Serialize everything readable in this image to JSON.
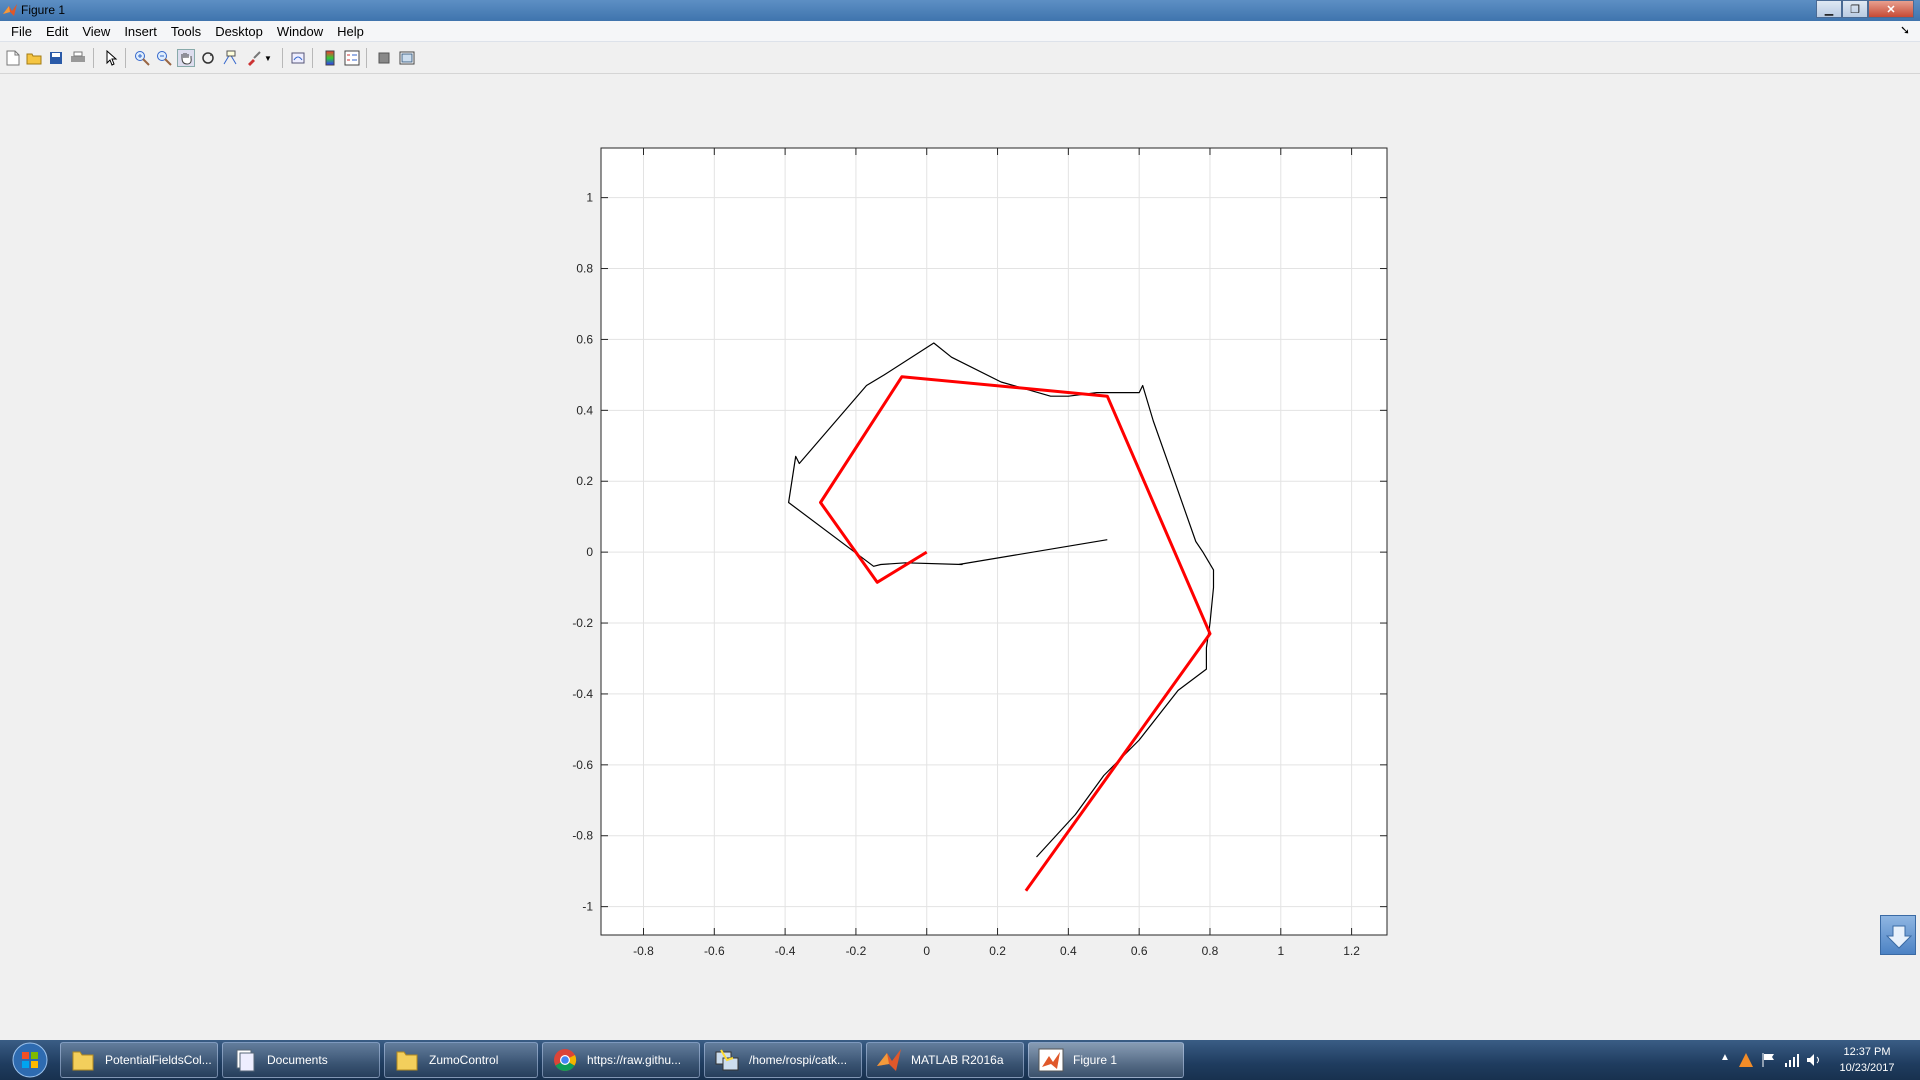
{
  "window": {
    "title": "Figure 1",
    "controls": [
      "minimize",
      "maximize",
      "close"
    ]
  },
  "menu": {
    "items": [
      "File",
      "Edit",
      "View",
      "Insert",
      "Tools",
      "Desktop",
      "Window",
      "Help"
    ]
  },
  "toolbar": {
    "icons": [
      "new-figure-icon",
      "open-icon",
      "save-icon",
      "print-icon",
      "select-arrow-icon",
      "zoom-in-icon",
      "zoom-out-icon",
      "pan-hand-icon",
      "rotate-3d-icon",
      "data-cursor-icon",
      "brush-icon",
      "link-plot-icon",
      "colorbar-icon",
      "legend-icon",
      "hide-plot-tools-icon",
      "show-plot-tools-icon"
    ],
    "active": "pan-hand-icon"
  },
  "chart_data": {
    "type": "line",
    "title": "",
    "xlabel": "",
    "ylabel": "",
    "xlim": [
      -0.92,
      1.3
    ],
    "ylim": [
      -1.08,
      1.14
    ],
    "xticks": [
      -0.8,
      -0.6,
      -0.4,
      -0.2,
      0,
      0.2,
      0.4,
      0.6,
      0.8,
      1,
      1.2
    ],
    "xtick_labels": [
      "-0.8",
      "-0.6",
      "-0.4",
      "-0.2",
      "0",
      "0.2",
      "0.4",
      "0.6",
      "0.8",
      "1",
      "1.2"
    ],
    "yticks": [
      -1,
      -0.8,
      -0.6,
      -0.4,
      -0.2,
      0,
      0.2,
      0.4,
      0.6,
      0.8,
      1
    ],
    "ytick_labels": [
      "-1",
      "-0.8",
      "-0.6",
      "-0.4",
      "-0.2",
      "0",
      "0.2",
      "0.4",
      "0.6",
      "0.8",
      "1"
    ],
    "grid": true,
    "series": [
      {
        "color": "#ff0000",
        "points": [
          [
            0,
            0
          ],
          [
            -0.14,
            -0.085
          ],
          [
            -0.3,
            0.14
          ],
          [
            -0.07,
            0.495
          ],
          [
            0.51,
            0.44
          ],
          [
            0.8,
            -0.23
          ],
          [
            0.28,
            -0.955
          ]
        ]
      },
      {
        "color": "#000000",
        "points": [
          [
            0.51,
            0.035
          ],
          [
            0.09,
            -0.035
          ],
          [
            0.1,
            -0.035
          ],
          [
            -0.06,
            -0.03
          ],
          [
            -0.13,
            -0.035
          ],
          [
            -0.15,
            -0.04
          ],
          [
            -0.39,
            0.14
          ],
          [
            -0.37,
            0.27
          ],
          [
            -0.36,
            0.25
          ],
          [
            -0.17,
            0.47
          ],
          [
            -0.12,
            0.5
          ],
          [
            0.02,
            0.59
          ],
          [
            0.07,
            0.55
          ],
          [
            0.21,
            0.48
          ],
          [
            0.35,
            0.44
          ],
          [
            0.4,
            0.44
          ],
          [
            0.48,
            0.45
          ],
          [
            0.6,
            0.45
          ],
          [
            0.61,
            0.47
          ],
          [
            0.64,
            0.37
          ],
          [
            0.7,
            0.2
          ],
          [
            0.76,
            0.03
          ],
          [
            0.78,
            0.0
          ],
          [
            0.81,
            -0.05
          ],
          [
            0.81,
            -0.1
          ],
          [
            0.8,
            -0.2
          ],
          [
            0.79,
            -0.27
          ],
          [
            0.79,
            -0.33
          ],
          [
            0.71,
            -0.39
          ],
          [
            0.6,
            -0.53
          ],
          [
            0.5,
            -0.63
          ],
          [
            0.42,
            -0.74
          ],
          [
            0.31,
            -0.86
          ]
        ]
      }
    ]
  },
  "taskbar": {
    "items": [
      {
        "label": "PotentialFieldsCol...",
        "icon": "folder-icon"
      },
      {
        "label": "Documents",
        "icon": "documents-icon"
      },
      {
        "label": "ZumoControl",
        "icon": "folder-icon"
      },
      {
        "label": "https://raw.githu...",
        "icon": "chrome-icon"
      },
      {
        "label": "/home/rospi/catk...",
        "icon": "putty-icon"
      },
      {
        "label": "MATLAB R2016a",
        "icon": "matlab-icon"
      },
      {
        "label": "Figure 1",
        "icon": "matlab-figure-icon"
      }
    ],
    "active": "Figure 1",
    "clock_time": "12:37 PM",
    "clock_date": "10/23/2017"
  }
}
